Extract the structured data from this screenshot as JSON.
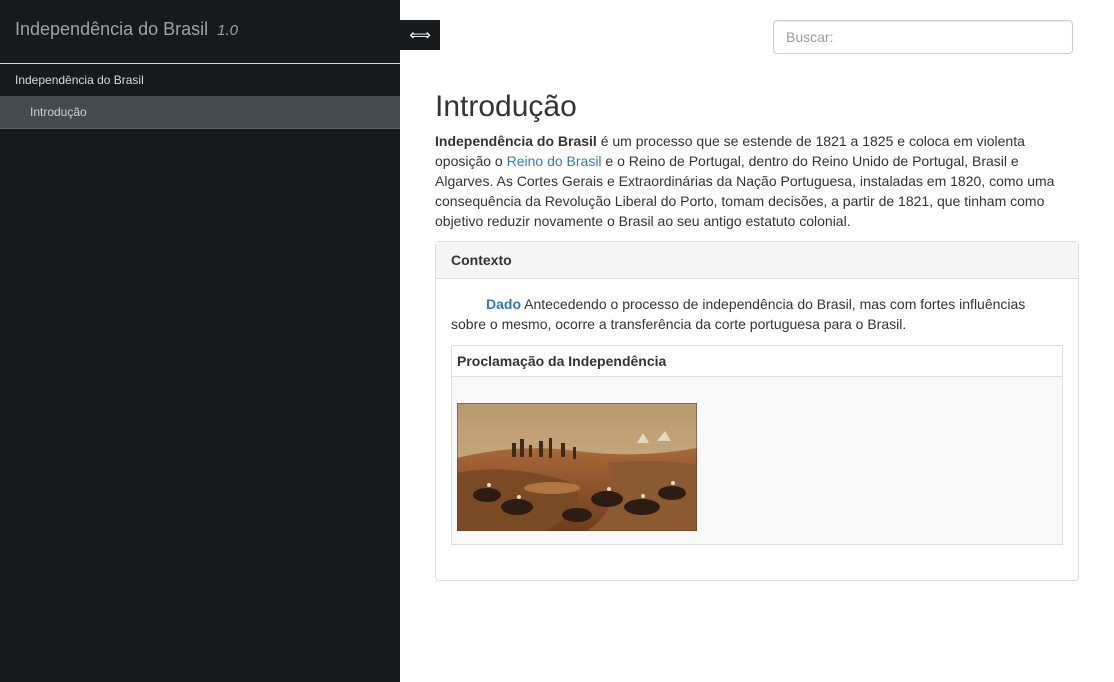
{
  "sidebar": {
    "title": "Independência do Brasil",
    "version": "1.0",
    "book_label": "Independência do Brasil",
    "chapters": [
      {
        "label": "Introdução",
        "active": true
      }
    ],
    "toggle_icon": "⟺"
  },
  "search": {
    "placeholder": "Buscar:"
  },
  "main": {
    "title": "Introdução",
    "intro": {
      "lead_bold": "Independência do Brasil",
      "text1": " é um processo que se estende de 1821 a 1825 e coloca em violenta oposição o ",
      "link": "Reino do Brasil",
      "text2": " e o Reino de Portugal, dentro do Reino Unido de Portugal, Brasil e Algarves. As Cortes Gerais e Extraordinárias da Nação Portuguesa, instaladas em 1820, como uma consequência da Revolução Liberal do Porto, tomam decisões, a partir de 1821, que tinham como objetivo reduzir novamente o Brasil ao seu antigo estatuto colonial."
    },
    "panel": {
      "heading": "Contexto",
      "fact_label": "Dado",
      "fact_text": " Antecedendo o processo de independência do Brasil, mas com fortes influências sobre o mesmo, ocorre a transferência da corte portuguesa para o Brasil.",
      "figure": {
        "heading": "Proclamação da Independência",
        "image_name": "painting-thumbnail"
      }
    }
  },
  "colors": {
    "sidebar_bg": "#161a1d",
    "active_item_bg": "#454a4f",
    "link": "#337ab7"
  }
}
